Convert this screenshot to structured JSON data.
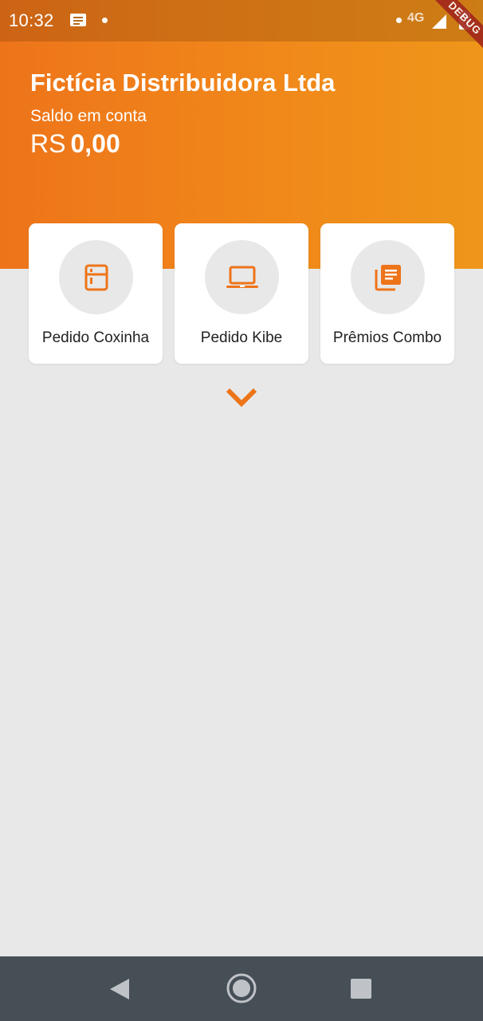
{
  "status_bar": {
    "time": "10:32",
    "network": "4G",
    "icons": [
      "notification-message-icon",
      "signal-icon",
      "battery-charging-icon"
    ]
  },
  "debug_banner": "DEBUG",
  "header": {
    "company": "Fictícia Distribuidora Ltda",
    "balance_label": "Saldo em conta",
    "currency": "RS",
    "amount": "0,00"
  },
  "cards": [
    {
      "label": "Pedido Coxinha",
      "icon": "fridge-icon"
    },
    {
      "label": "Pedido Kibe",
      "icon": "laptop-icon"
    },
    {
      "label": "Prêmios Combo",
      "icon": "library-books-icon"
    }
  ],
  "expand_icon": "chevron-down-icon",
  "nav_bar": {
    "icons": [
      "back-icon",
      "home-icon",
      "recents-icon"
    ]
  },
  "colors": {
    "accent": "#ee741a",
    "accent_end": "#ef961a",
    "background": "#e8e8e8",
    "card": "#ffffff",
    "nav_bar": "#464e56",
    "debug_ribbon": "#a2271c"
  }
}
